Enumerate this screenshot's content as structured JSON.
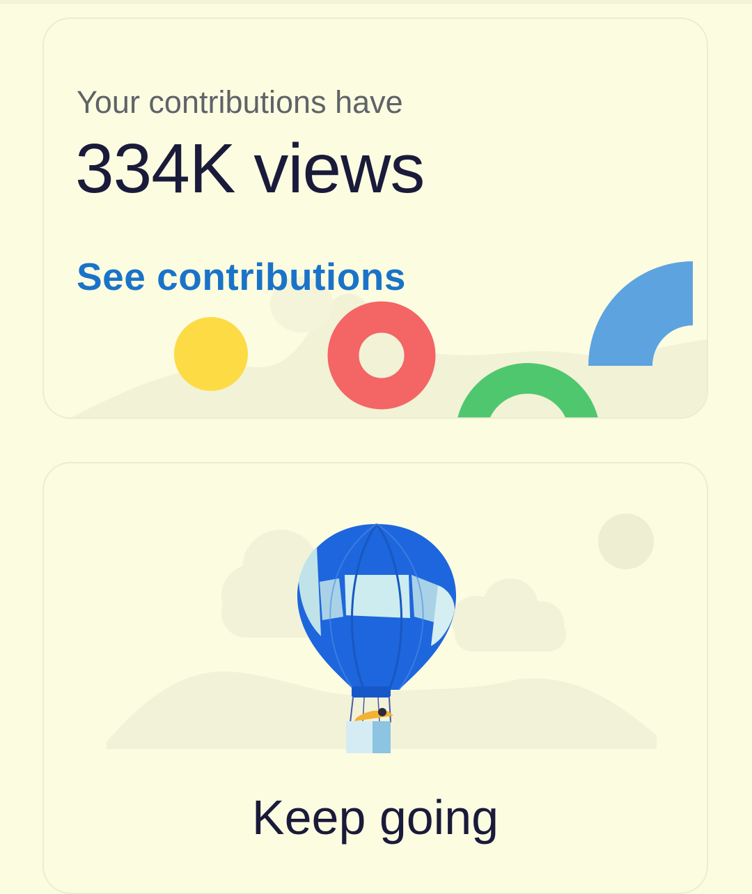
{
  "contributions_card": {
    "subtitle": "Your contributions have",
    "headline": "334K views",
    "link_label": "See contributions",
    "shape_colors": {
      "yellow": "#FDDB45",
      "red": "#F46565",
      "green": "#4FC76F",
      "blue": "#5DA3E0"
    }
  },
  "progress_card": {
    "illustration": "hot-air-balloon",
    "message": "Keep going",
    "balloon_colors": {
      "primary": "#1E66DD",
      "light": "#BFE3E8"
    }
  },
  "colors": {
    "background": "#FCFCE1",
    "link": "#1A73C8",
    "text": "#1A1A3A",
    "muted": "#5F6368"
  }
}
